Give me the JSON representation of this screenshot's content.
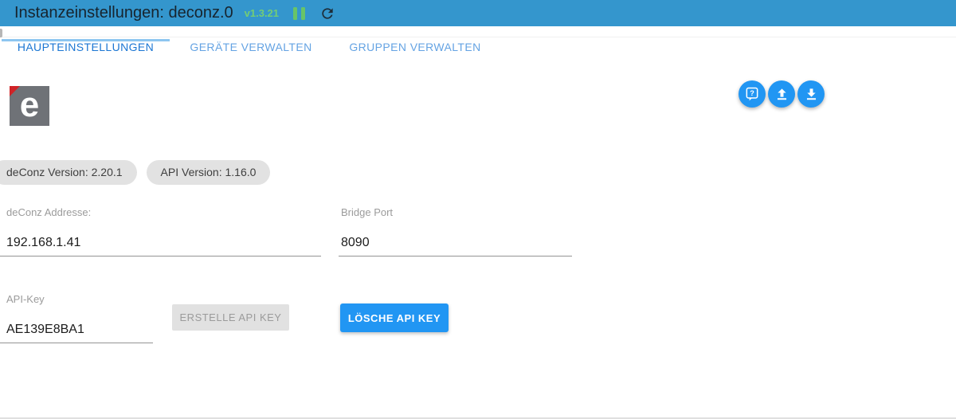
{
  "header": {
    "title": "Instanzeinstellungen: deconz.0",
    "version": "v1.3.21",
    "icons": [
      "pause-icon",
      "refresh-icon"
    ]
  },
  "tabs": [
    {
      "label": "HAUPTEINSTELLUNGEN",
      "active": true
    },
    {
      "label": "GERÄTE VERWALTEN",
      "active": false
    },
    {
      "label": "GRUPPEN VERWALTEN",
      "active": false
    }
  ],
  "toolbar": {
    "icons": [
      "help-icon",
      "upload-icon",
      "download-icon"
    ]
  },
  "logo": {
    "letter": "e"
  },
  "chips": [
    {
      "label": "deConz Version: 2.20.1"
    },
    {
      "label": "API Version: 1.16.0"
    }
  ],
  "form": {
    "address": {
      "label": "deConz Addresse:",
      "value": "192.168.1.41"
    },
    "port": {
      "label": "Bridge Port",
      "value": "8090"
    },
    "api_key": {
      "label": "API-Key",
      "value": "AE139E8BA1"
    },
    "buttons": {
      "create": "ERSTELLE API KEY",
      "delete": "LÖSCHE API KEY"
    }
  },
  "colors": {
    "header_bar": "#3496cd",
    "version_green": "#74cd74",
    "pause_green": "#68c468",
    "active_tab_blue": "#1b76d3",
    "inactive_tab_blue": "#64a3e3",
    "tab_indicator": "#8dc6f0",
    "fab_blue": "#2196f3",
    "primary_button_blue": "#2196f3",
    "disabled_button_bg": "#e1e1e1",
    "chip_bg": "#e2e2e2",
    "logo_gray": "#6f7277",
    "logo_red": "#d02327"
  }
}
